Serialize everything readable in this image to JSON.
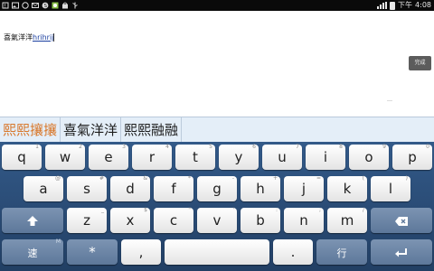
{
  "status_bar": {
    "time": "4:08",
    "ampm": "下午",
    "left_icons": [
      "notification-icon",
      "image-icon",
      "whatsapp-icon",
      "mail-icon",
      "skype-icon",
      "photo-icon",
      "bag-icon",
      "usb-icon"
    ]
  },
  "editor": {
    "committed_text": "喜氣洋洋",
    "composing_text": "hrihrij",
    "done_label": "完成"
  },
  "candidates": [
    "熙熙攘攘",
    "喜氣洋洋",
    "熙熙融融"
  ],
  "keyboard": {
    "row1": [
      {
        "label": "q",
        "hint": "1"
      },
      {
        "label": "w",
        "hint": "2"
      },
      {
        "label": "e",
        "hint": "3"
      },
      {
        "label": "r",
        "hint": "4"
      },
      {
        "label": "t",
        "hint": "5"
      },
      {
        "label": "y",
        "hint": "6"
      },
      {
        "label": "u",
        "hint": "7"
      },
      {
        "label": "i",
        "hint": "8"
      },
      {
        "label": "o",
        "hint": "9"
      },
      {
        "label": "p",
        "hint": "0"
      }
    ],
    "row2": [
      {
        "label": "a",
        "hint": "@"
      },
      {
        "label": "s",
        "hint": "#"
      },
      {
        "label": "d",
        "hint": "&"
      },
      {
        "label": "f",
        "hint": "*"
      },
      {
        "label": "g",
        "hint": "-"
      },
      {
        "label": "h",
        "hint": "+"
      },
      {
        "label": "j",
        "hint": "="
      },
      {
        "label": "k",
        "hint": "("
      },
      {
        "label": "l",
        "hint": ")"
      }
    ],
    "row3": [
      {
        "label": "z",
        "hint": "_"
      },
      {
        "label": "x",
        "hint": "$"
      },
      {
        "label": "c",
        "hint": "\""
      },
      {
        "label": "v",
        "hint": "'"
      },
      {
        "label": "b",
        "hint": ":"
      },
      {
        "label": "n",
        "hint": ";"
      },
      {
        "label": "m",
        "hint": "/"
      }
    ],
    "shift_icon": "shift-arrow-icon",
    "backspace_icon": "backspace-icon",
    "mode_label": "速",
    "mode_hint": "M",
    "star_label": "*",
    "comma_label": ",",
    "period_label": ".",
    "row_label": "行",
    "enter_icon": "enter-icon"
  },
  "colors": {
    "keyboard_top": "#335a89",
    "keyboard_bottom": "#223f64",
    "candidate_bar": "#e4eef8",
    "first_candidate": "#d8772a",
    "done_button": "#5c5c5c"
  }
}
